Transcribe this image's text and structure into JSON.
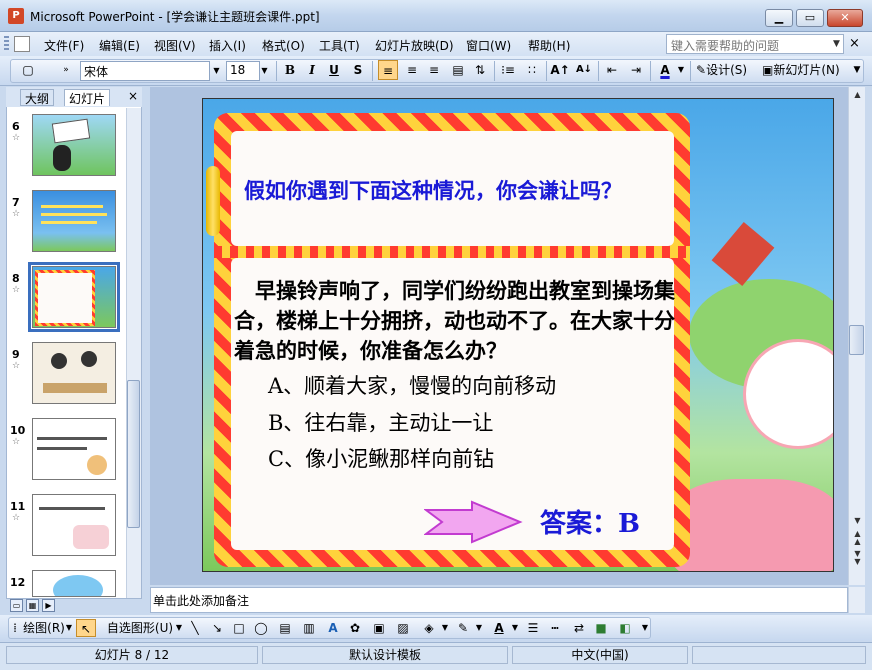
{
  "window": {
    "title": "Microsoft PowerPoint - [学会谦让主题班会课件.ppt]",
    "app_icon": "powerpoint-icon",
    "buttons": {
      "minimize": "▁",
      "restore": "▭",
      "close": "✕"
    }
  },
  "menu": {
    "items": [
      "文件(F)",
      "编辑(E)",
      "视图(V)",
      "插入(I)",
      "格式(O)",
      "工具(T)",
      "幻灯片放映(D)",
      "窗口(W)",
      "帮助(H)"
    ],
    "help_placeholder": "键入需要帮助的问题",
    "close": "×"
  },
  "format_toolbar": {
    "font_name": "宋体",
    "font_size": "18",
    "bold": "B",
    "italic": "I",
    "underline": "U",
    "shadow": "S",
    "design_label": "设计(S)",
    "new_slide_label": "新幻灯片(N)"
  },
  "left_pane": {
    "tabs": [
      "大纲",
      "幻灯片"
    ],
    "close": "×",
    "slides": [
      {
        "number": "6",
        "selected": false
      },
      {
        "number": "7",
        "selected": false
      },
      {
        "number": "8",
        "selected": true
      },
      {
        "number": "9",
        "selected": false
      },
      {
        "number": "10",
        "selected": false
      },
      {
        "number": "11",
        "selected": false
      },
      {
        "number": "12",
        "selected": false
      }
    ]
  },
  "slide": {
    "question_title": "假如你遇到下面这种情况，你会谦让吗？",
    "scenario": "　早操铃声响了，同学们纷纷跑出教室到操场集合，楼梯上十分拥挤，动也动不了。在大家十分着急的时候，你准备怎么办？",
    "options": [
      "A、顺着大家，慢慢的向前移动",
      "B、往右靠，主动让一让",
      "C、像小泥鳅那样向前钻"
    ],
    "answer": "答案：B"
  },
  "notes": {
    "placeholder": "单击此处添加备注"
  },
  "draw_toolbar": {
    "draw_label": "绘图(R)",
    "autoshape_label": "自选图形(U)"
  },
  "status": {
    "slide_position": "幻灯片 8 / 12",
    "template": "默认设计模板",
    "language": "中文(中国)"
  },
  "colors": {
    "accent": "#1a1ad6",
    "frame_red": "#ff3b30",
    "frame_yellow": "#ffd23c"
  }
}
